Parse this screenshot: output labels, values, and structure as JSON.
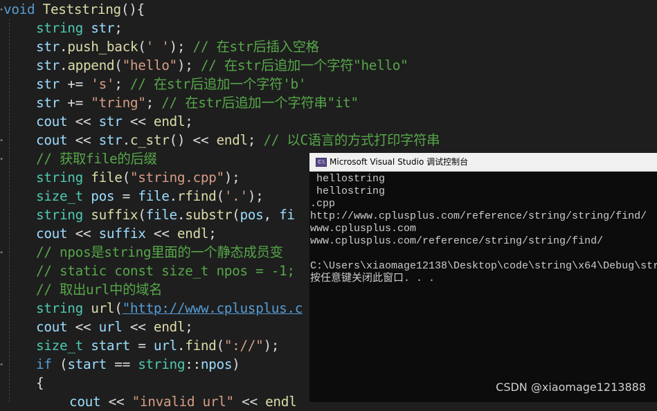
{
  "editor": {
    "lines": [
      [
        {
          "c": "kw",
          "t": "void"
        },
        {
          "c": "pl",
          "t": " "
        },
        {
          "c": "fn",
          "t": "Teststring"
        },
        {
          "c": "pl",
          "t": "(){"
        }
      ],
      [
        {
          "c": "ty",
          "t": "string"
        },
        {
          "c": "pl",
          "t": " "
        },
        {
          "c": "id",
          "t": "str"
        },
        {
          "c": "pl",
          "t": ";"
        }
      ],
      [
        {
          "c": "id",
          "t": "str"
        },
        {
          "c": "pl",
          "t": "."
        },
        {
          "c": "fn",
          "t": "push_back"
        },
        {
          "c": "pl",
          "t": "("
        },
        {
          "c": "str",
          "t": "' '"
        },
        {
          "c": "pl",
          "t": "); "
        },
        {
          "c": "cm",
          "t": "// 在str后插入空格"
        }
      ],
      [
        {
          "c": "id",
          "t": "str"
        },
        {
          "c": "pl",
          "t": "."
        },
        {
          "c": "fn",
          "t": "append"
        },
        {
          "c": "pl",
          "t": "("
        },
        {
          "c": "str",
          "t": "\"hello\""
        },
        {
          "c": "pl",
          "t": "); "
        },
        {
          "c": "cm",
          "t": "// 在str后追加一个字符\"hello\""
        }
      ],
      [
        {
          "c": "id",
          "t": "str"
        },
        {
          "c": "pl",
          "t": " += "
        },
        {
          "c": "str",
          "t": "'s'"
        },
        {
          "c": "pl",
          "t": "; "
        },
        {
          "c": "cm",
          "t": "// 在str后追加一个字符'b'"
        }
      ],
      [
        {
          "c": "id",
          "t": "str"
        },
        {
          "c": "pl",
          "t": " += "
        },
        {
          "c": "str",
          "t": "\"tring\""
        },
        {
          "c": "pl",
          "t": "; "
        },
        {
          "c": "cm",
          "t": "// 在str后追加一个字符串\"it\""
        }
      ],
      [
        {
          "c": "id",
          "t": "cout"
        },
        {
          "c": "pl",
          "t": " << "
        },
        {
          "c": "id",
          "t": "str"
        },
        {
          "c": "pl",
          "t": " << "
        },
        {
          "c": "fn",
          "t": "endl"
        },
        {
          "c": "pl",
          "t": ";"
        }
      ],
      [
        {
          "c": "id",
          "t": "cout"
        },
        {
          "c": "pl",
          "t": " << "
        },
        {
          "c": "id",
          "t": "str"
        },
        {
          "c": "pl",
          "t": "."
        },
        {
          "c": "fn",
          "t": "c_str"
        },
        {
          "c": "pl",
          "t": "() << "
        },
        {
          "c": "fn",
          "t": "endl"
        },
        {
          "c": "pl",
          "t": "; "
        },
        {
          "c": "cm",
          "t": "// 以C语言的方式打印字符串"
        }
      ],
      [
        {
          "c": "cm",
          "t": "// 获取file的后缀"
        }
      ],
      [
        {
          "c": "ty",
          "t": "string"
        },
        {
          "c": "pl",
          "t": " "
        },
        {
          "c": "fn",
          "t": "file"
        },
        {
          "c": "pl",
          "t": "("
        },
        {
          "c": "str",
          "t": "\"string.cpp\""
        },
        {
          "c": "pl",
          "t": ");"
        }
      ],
      [
        {
          "c": "ty",
          "t": "size_t"
        },
        {
          "c": "pl",
          "t": " "
        },
        {
          "c": "id",
          "t": "pos"
        },
        {
          "c": "pl",
          "t": " = "
        },
        {
          "c": "id",
          "t": "file"
        },
        {
          "c": "pl",
          "t": "."
        },
        {
          "c": "fn",
          "t": "rfind"
        },
        {
          "c": "pl",
          "t": "("
        },
        {
          "c": "str",
          "t": "'.'"
        },
        {
          "c": "pl",
          "t": ");"
        }
      ],
      [
        {
          "c": "ty",
          "t": "string"
        },
        {
          "c": "pl",
          "t": " "
        },
        {
          "c": "fn",
          "t": "suffix"
        },
        {
          "c": "pl",
          "t": "("
        },
        {
          "c": "id",
          "t": "file"
        },
        {
          "c": "pl",
          "t": "."
        },
        {
          "c": "fn",
          "t": "substr"
        },
        {
          "c": "pl",
          "t": "("
        },
        {
          "c": "id",
          "t": "pos"
        },
        {
          "c": "pl",
          "t": ", "
        },
        {
          "c": "id",
          "t": "fi"
        }
      ],
      [
        {
          "c": "id",
          "t": "cout"
        },
        {
          "c": "pl",
          "t": " << "
        },
        {
          "c": "id",
          "t": "suffix"
        },
        {
          "c": "pl",
          "t": " << "
        },
        {
          "c": "fn",
          "t": "endl"
        },
        {
          "c": "pl",
          "t": ";"
        }
      ],
      [
        {
          "c": "cm",
          "t": "// npos是string里面的一个静态成员变"
        }
      ],
      [
        {
          "c": "cm",
          "t": "// static const size_t npos = -1;"
        }
      ],
      [
        {
          "c": "cm",
          "t": "// 取出url中的域名"
        }
      ],
      [
        {
          "c": "ty",
          "t": "string"
        },
        {
          "c": "pl",
          "t": " "
        },
        {
          "c": "fn",
          "t": "url"
        },
        {
          "c": "pl",
          "t": "("
        },
        {
          "c": "url",
          "t": "\"http://www.cplusplus.c"
        }
      ],
      [
        {
          "c": "id",
          "t": "cout"
        },
        {
          "c": "pl",
          "t": " << "
        },
        {
          "c": "id",
          "t": "url"
        },
        {
          "c": "pl",
          "t": " << "
        },
        {
          "c": "fn",
          "t": "endl"
        },
        {
          "c": "pl",
          "t": ";"
        }
      ],
      [
        {
          "c": "ty",
          "t": "size_t"
        },
        {
          "c": "pl",
          "t": " "
        },
        {
          "c": "id",
          "t": "start"
        },
        {
          "c": "pl",
          "t": " = "
        },
        {
          "c": "id",
          "t": "url"
        },
        {
          "c": "pl",
          "t": "."
        },
        {
          "c": "fn",
          "t": "find"
        },
        {
          "c": "pl",
          "t": "("
        },
        {
          "c": "str",
          "t": "\"://\""
        },
        {
          "c": "pl",
          "t": ");"
        }
      ],
      [
        {
          "c": "kw",
          "t": "if"
        },
        {
          "c": "pl",
          "t": " ("
        },
        {
          "c": "id",
          "t": "start"
        },
        {
          "c": "pl",
          "t": " == "
        },
        {
          "c": "ty",
          "t": "string"
        },
        {
          "c": "pl",
          "t": "::"
        },
        {
          "c": "id",
          "t": "npos"
        },
        {
          "c": "pl",
          "t": ")"
        }
      ],
      [
        {
          "c": "pl",
          "t": "{"
        }
      ],
      [
        {
          "c": "id",
          "t": "cout"
        },
        {
          "c": "pl",
          "t": " << "
        },
        {
          "c": "str",
          "t": "\"invalid url\""
        },
        {
          "c": "pl",
          "t": " << "
        },
        {
          "c": "fn",
          "t": "endl"
        }
      ]
    ]
  },
  "console": {
    "title": "Microsoft Visual Studio 调试控制台",
    "icon_name": "console-app-icon",
    "icon_text": "C:\\",
    "output": [
      " hellostring",
      " hellostring",
      ".cpp",
      "http://www.cplusplus.com/reference/string/string/find/",
      "www.cplusplus.com",
      "www.cplusplus.com/reference/string/string/find/",
      "",
      "C:\\Users\\xiaomage12138\\Desktop\\code\\string\\x64\\Debug\\str",
      "按任意键关闭此窗口. . ."
    ]
  },
  "watermark": "CSDN @xiaomage1213888",
  "colors": {
    "editor_bg": "#1e1e1e",
    "keyword": "#569cd6",
    "type": "#4ec9b0",
    "function": "#dcdcaa",
    "string": "#d69d85",
    "comment": "#57a64a",
    "identifier": "#9cdcfe",
    "console_bg": "#0c0c0c",
    "console_text": "#cccccc"
  }
}
